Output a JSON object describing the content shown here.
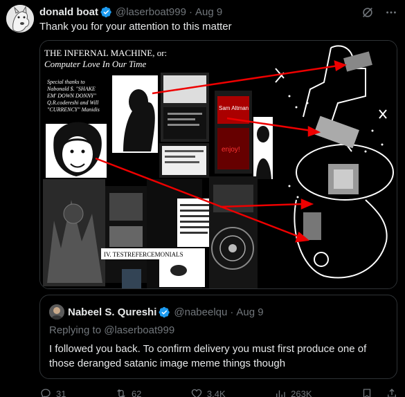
{
  "tweet": {
    "author_name": "donald boat",
    "author_handle": "@laserboat999",
    "time": "Aug 9",
    "text": "Thank you for your attention to this matter"
  },
  "image": {
    "title_line1": "THE INFERNAL MACHINE, or:",
    "title_line2": "Computer Love In Our Time",
    "thanks_line1": "Special thanks to",
    "thanks_line2": "Nabonald $. \"SHAKE",
    "thanks_line3": "EM' DOWN DONNY\"",
    "thanks_line4": "Q.R.codereshi and Will",
    "thanks_line5": "\"CURRENCY\" Manidis",
    "label_sam": "Sam Altman",
    "label_testref": "IV. TESTREFERCEMONIALS"
  },
  "quote": {
    "author_name": "Nabeel S. Qureshi",
    "author_handle": "@nabeelqu",
    "time": "Aug 9",
    "reply_prefix": "Replying to",
    "reply_mention": "@laserboat999",
    "text": "I followed you back. To confirm delivery you must first produce one of those deranged satanic image meme things though"
  },
  "actions": {
    "replies": "31",
    "reposts": "62",
    "likes": "3.4K",
    "views": "263K"
  },
  "colors": {
    "verified": "#1d9bf0",
    "muted": "#71767b",
    "text": "#e7e9ea",
    "border": "#2f3336"
  }
}
